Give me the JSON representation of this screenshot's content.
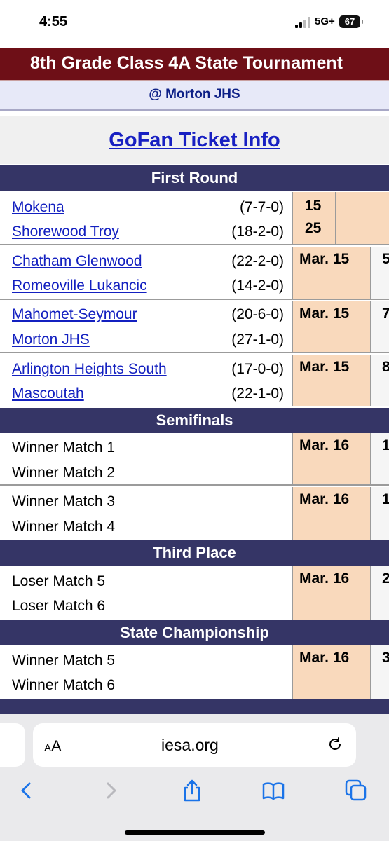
{
  "status_bar": {
    "time": "4:55",
    "network": "5G+",
    "battery": "67"
  },
  "header": {
    "title": "8th Grade Class 4A State Tournament",
    "location": "@ Morton JHS",
    "ticket_link": "GoFan Ticket Info"
  },
  "sections": {
    "first_round": "First Round",
    "semifinals": "Semifinals",
    "third_place": "Third Place",
    "championship": "State Championship"
  },
  "first_round": [
    {
      "team1": "Mokena",
      "rec1": "(7-7-0)",
      "team2": "Shorewood Troy",
      "rec2": "(18-2-0)",
      "score1": "15",
      "score2": "25"
    },
    {
      "team1": "Chatham Glenwood",
      "rec1": "(22-2-0)",
      "team2": "Romeoville Lukancic",
      "rec2": "(14-2-0)",
      "date": "Mar. 15",
      "extra": "5"
    },
    {
      "team1": "Mahomet-Seymour",
      "rec1": "(20-6-0)",
      "team2": "Morton JHS",
      "rec2": "(27-1-0)",
      "date": "Mar. 15",
      "extra": "7"
    },
    {
      "team1": "Arlington Heights South",
      "rec1": "(17-0-0)",
      "team2": "Mascoutah",
      "rec2": "(22-1-0)",
      "date": "Mar. 15",
      "extra": "8"
    }
  ],
  "semifinals": [
    {
      "team1": "Winner Match 1",
      "team2": "Winner Match 2",
      "date": "Mar. 16",
      "extra": "1"
    },
    {
      "team1": "Winner Match 3",
      "team2": "Winner Match 4",
      "date": "Mar. 16",
      "extra": "1"
    }
  ],
  "third_place": [
    {
      "team1": "Loser Match 5",
      "team2": "Loser Match 6",
      "date": "Mar. 16",
      "extra": "2"
    }
  ],
  "championship": [
    {
      "team1": "Winner Match 5",
      "team2": "Winner Match 6",
      "date": "Mar. 16",
      "extra": "3"
    }
  ],
  "browser": {
    "aa_label": "AA",
    "domain": "iesa.org"
  },
  "icons": [
    "back-icon",
    "forward-icon",
    "share-icon",
    "bookmarks-icon",
    "tabs-icon",
    "reload-icon"
  ]
}
